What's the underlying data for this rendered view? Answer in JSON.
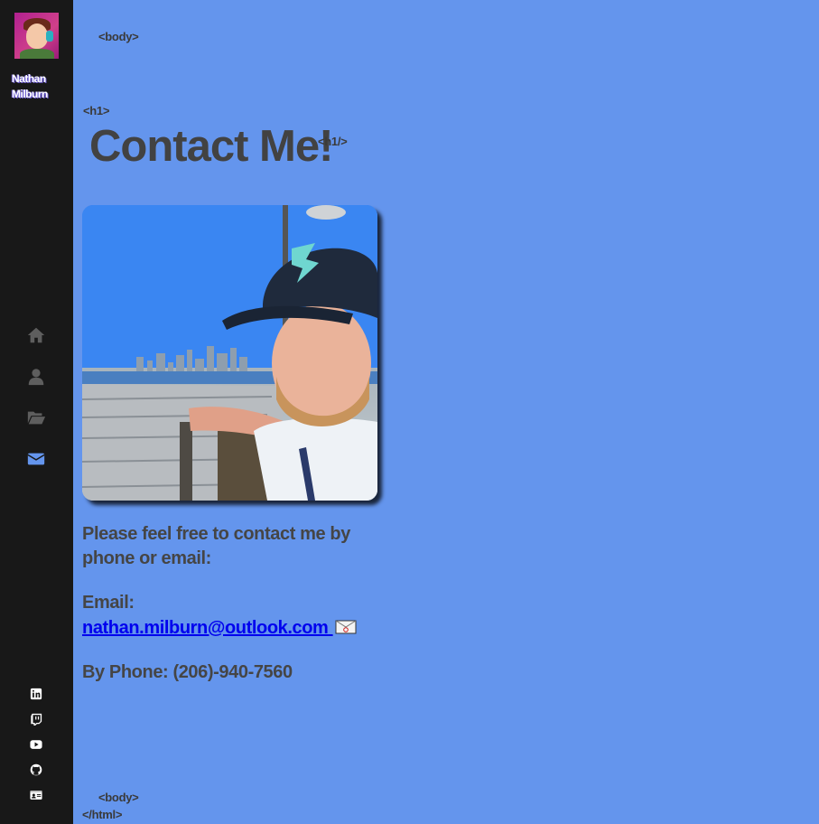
{
  "sidebar": {
    "brand_name": "Nathan Milburn",
    "nav": [
      {
        "icon": "home-icon",
        "active": false
      },
      {
        "icon": "user-icon",
        "active": false
      },
      {
        "icon": "folder-open-icon",
        "active": false
      },
      {
        "icon": "envelope-icon",
        "active": true
      }
    ],
    "social": [
      "linkedin-icon",
      "twitch-icon",
      "youtube-icon",
      "github-icon",
      "id-card-icon"
    ]
  },
  "tags": {
    "body_open": "<body>",
    "h1_open": "<h1>",
    "h1_close": "<h1/>",
    "body_close": "<body>",
    "html_close": "</html>"
  },
  "main": {
    "title": "Contact Me!",
    "intro": "Please feel free to contact me by phone or email:",
    "email_label": "Email:",
    "email_address": "nathan.milburn@outlook.com",
    "phone": "By Phone: (206)-940-7560"
  },
  "colors": {
    "background": "#6495ed",
    "sidebar": "#181818",
    "icon_inactive": "#5e5e5e",
    "icon_active": "#6495ed",
    "text": "#424242",
    "link": "#0000ee"
  }
}
